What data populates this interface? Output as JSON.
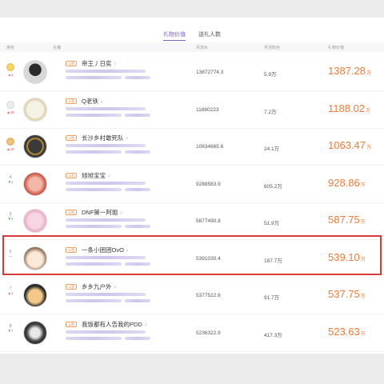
{
  "tabs": [
    {
      "label": "礼物价值",
      "active": true
    },
    {
      "label": "送礼人数",
      "active": false
    }
  ],
  "columns": {
    "rank": "排名",
    "host": "主播",
    "col1": "月流水",
    "col2": "月活粉丝",
    "col3": "礼物价值"
  },
  "tag_label": "斗鱼",
  "unit": "万",
  "rows": [
    {
      "rank": "1",
      "medal": "gold",
      "delta": "▲3",
      "delta_dir": "up",
      "name": "帝王丿日奕",
      "gender": "male",
      "v1": "13872774.3",
      "v2": "5.9万",
      "gift": "1387.28"
    },
    {
      "rank": "2",
      "medal": "silver",
      "delta": "▲49",
      "delta_dir": "up",
      "name": "Q老铁",
      "gender": "male",
      "v1": "11880223",
      "v2": "7.2万",
      "gift": "1188.02"
    },
    {
      "rank": "3",
      "medal": "bronze",
      "delta": "▲16",
      "delta_dir": "up",
      "name": "长沙乡村敢死队",
      "gender": "male",
      "v1": "10634665.6",
      "v2": "24.1万",
      "gift": "1063.47"
    },
    {
      "rank": "4",
      "medal": "",
      "delta": "▼1",
      "delta_dir": "down",
      "name": "旭旭宝宝",
      "gender": "male",
      "v1": "9288583.9",
      "v2": "605.2万",
      "gift": "928.86"
    },
    {
      "rank": "5",
      "medal": "",
      "delta": "▼2",
      "delta_dir": "down",
      "name": "DNF第一阿姐",
      "gender": "male",
      "v1": "5877490.8",
      "v2": "51.9万",
      "gift": "587.75"
    },
    {
      "rank": "6",
      "medal": "",
      "delta": "—",
      "delta_dir": "",
      "name": "一条小团团OvO",
      "gender": "female",
      "v1": "5391030.4",
      "v2": "187.7万",
      "gift": "539.10"
    },
    {
      "rank": "7",
      "medal": "",
      "delta": "▲1",
      "delta_dir": "up",
      "name": "乡乡九户外",
      "gender": "male",
      "v1": "5377522.6",
      "v2": "91.7万",
      "gift": "537.75"
    },
    {
      "rank": "8",
      "medal": "",
      "delta": "▼7",
      "delta_dir": "down",
      "name": "我饭都有人告我的PDD",
      "gender": "male",
      "v1": "5236322.9",
      "v2": "417.3万",
      "gift": "523.63"
    }
  ],
  "colors": {
    "accent": "#7b61c9",
    "gift": "#f07a3a",
    "highlight": "#d83a3a"
  }
}
